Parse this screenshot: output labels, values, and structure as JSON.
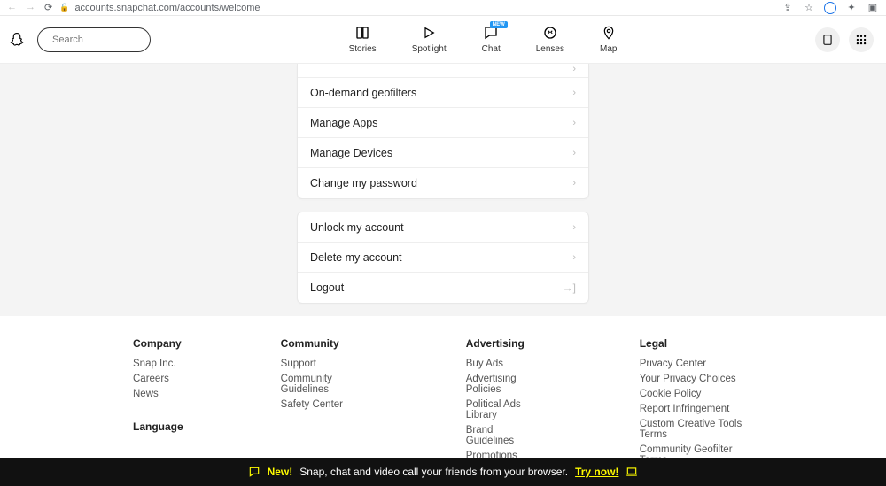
{
  "browser": {
    "url": "accounts.snapchat.com/accounts/welcome"
  },
  "search": {
    "placeholder": "Search"
  },
  "tabs": {
    "stories": "Stories",
    "spotlight": "Spotlight",
    "chat": "Chat",
    "chat_badge": "NEW",
    "lenses": "Lenses",
    "map": "Map"
  },
  "menu1": {
    "geofilters": "On-demand geofilters",
    "apps": "Manage Apps",
    "devices": "Manage Devices",
    "password": "Change my password"
  },
  "menu2": {
    "unlock": "Unlock my account",
    "delete": "Delete my account",
    "logout": "Logout"
  },
  "footer": {
    "company": {
      "h": "Company",
      "snap": "Snap Inc.",
      "careers": "Careers",
      "news": "News"
    },
    "language": {
      "h": "Language"
    },
    "community": {
      "h": "Community",
      "support": "Support",
      "guidelines": "Community Guidelines",
      "safety": "Safety Center"
    },
    "advertising": {
      "h": "Advertising",
      "buy": "Buy Ads",
      "policies": "Advertising Policies",
      "political": "Political Ads Library",
      "brand": "Brand Guidelines",
      "promo": "Promotions Rules"
    },
    "legal": {
      "h": "Legal",
      "privacy": "Privacy Center",
      "choices": "Your Privacy Choices",
      "cookie": "Cookie Policy",
      "report": "Report Infringement",
      "tools": "Custom Creative Tools Terms",
      "geo": "Community Geofilter Terms"
    }
  },
  "banner": {
    "new": "New!",
    "text": "Snap, chat and video call your friends from your browser.",
    "try": "Try now!"
  }
}
